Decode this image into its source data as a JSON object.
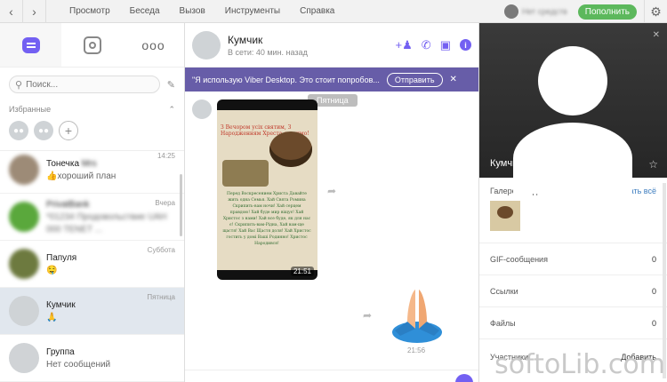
{
  "menu": [
    "Просмотр",
    "Беседа",
    "Вызов",
    "Инструменты",
    "Справка"
  ],
  "topbar": {
    "user_name": "Нет средств",
    "topup_label": "Пополнить"
  },
  "search": {
    "placeholder": "Поиск..."
  },
  "favorites": {
    "label": "Избранные"
  },
  "chats": [
    {
      "name": "Тонечка",
      "name_hidden": "Mrs",
      "msg": "хороший план",
      "time": "14:25"
    },
    {
      "name": "PrivatBank",
      "msg": "*01234 Продовольствие UAH",
      "msg2": "000 TENET ...",
      "time": "Вчера"
    },
    {
      "name": "Папуля",
      "msg": "🤤",
      "time": "Суббота"
    },
    {
      "name": "Кумчик",
      "msg": "🙏",
      "time": "Пятница"
    },
    {
      "name": "Группа",
      "msg": "Нет сообщений",
      "time": ""
    }
  ],
  "chat": {
    "name": "Кумчик",
    "status": "В сети: 40 мин. назад",
    "promo_text": "\"Я использую Viber Desktop. Это стоит попробов...",
    "promo_button": "Отправить",
    "day_label": "Пятница",
    "image_time": "21:51",
    "sticker_time": "21:56",
    "image_title": "З Вечором усіх святим, З Народженням Хреста святимо!",
    "image_text": "Перед Воскресением Христа Давайте жить одна Семья. Хай Свята Ромина Скрипить-вам ночи! Хай серцем правдою! Хай буде мир віщує! Хай Христос з нами! Хай все буде, як для нас є! Скрипить-вам-Рідна, Хай вам-ще щастя! Хай Вас Щастя доля! Хай Христос гостить у домі Ваші Родинно! Христос Народився!"
  },
  "profile": {
    "name": "Кумчик",
    "gallery_label": "Галерея медиа",
    "show_all": "показать всё",
    "gif_label": "GIF-сообщения",
    "gif_count": "0",
    "links_label": "Ссылки",
    "links_count": "0",
    "files_label": "Файлы",
    "files_count": "0",
    "members_label": "Участники",
    "add_label": "Добавить"
  },
  "watermark": "softoLib.com",
  "icons": [
    "back-icon",
    "forward-icon",
    "gear-icon",
    "chat-icon",
    "stories-icon",
    "more-icon",
    "search-icon",
    "edit-icon",
    "add-contact-icon",
    "call-icon",
    "video-icon",
    "info-icon",
    "close-icon",
    "star-icon",
    "forward-message-icon"
  ]
}
